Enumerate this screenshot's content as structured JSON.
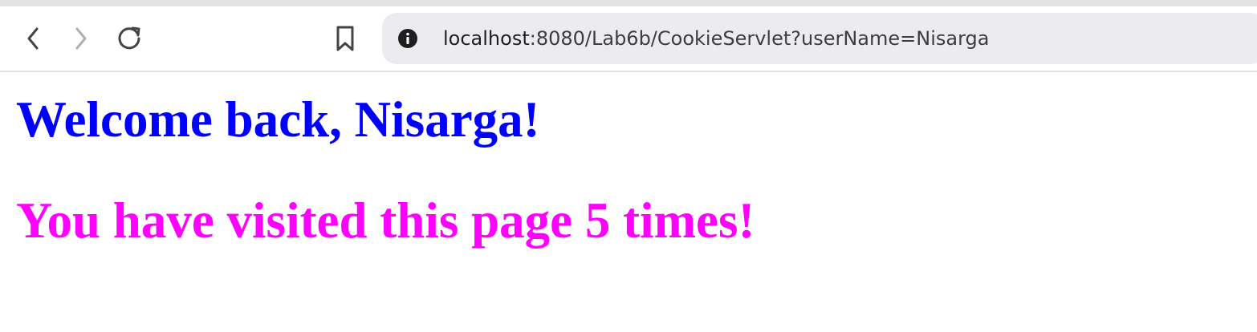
{
  "browser": {
    "url_host": "localhost",
    "url_rest": ":8080/Lab6b/CookieServlet?userName=Nisarga",
    "icons": {
      "back": "chevron-left-icon",
      "forward": "chevron-right-icon",
      "reload": "reload-icon",
      "bookmark": "bookmark-icon",
      "site_info": "info-icon"
    }
  },
  "page": {
    "welcome_text": "Welcome back, Nisarga!",
    "visits_text": "You have visited this page 5 times!",
    "welcome_color": "#0000ff",
    "visits_color": "#ff00ff"
  }
}
